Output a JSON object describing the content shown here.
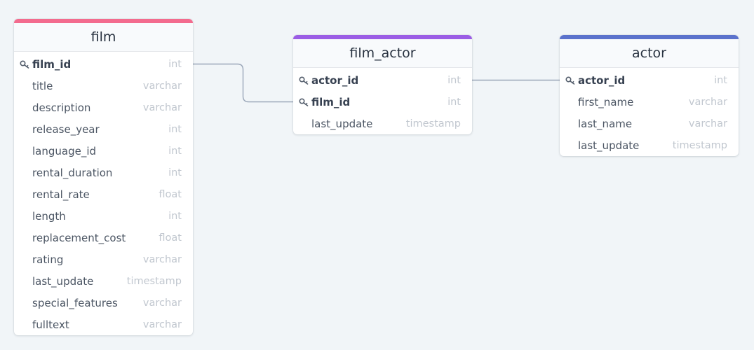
{
  "theme": {
    "background": "#f1f5f8",
    "link_color": "#9aa6b8"
  },
  "tables": [
    {
      "id": "film",
      "name": "film",
      "accent": "#f36b8e",
      "columns": [
        {
          "name": "film_id",
          "type": "int",
          "pk": true
        },
        {
          "name": "title",
          "type": "varchar",
          "pk": false
        },
        {
          "name": "description",
          "type": "varchar",
          "pk": false
        },
        {
          "name": "release_year",
          "type": "int",
          "pk": false
        },
        {
          "name": "language_id",
          "type": "int",
          "pk": false
        },
        {
          "name": "rental_duration",
          "type": "int",
          "pk": false
        },
        {
          "name": "rental_rate",
          "type": "float",
          "pk": false
        },
        {
          "name": "length",
          "type": "int",
          "pk": false
        },
        {
          "name": "replacement_cost",
          "type": "float",
          "pk": false
        },
        {
          "name": "rating",
          "type": "varchar",
          "pk": false
        },
        {
          "name": "last_update",
          "type": "timestamp",
          "pk": false
        },
        {
          "name": "special_features",
          "type": "varchar",
          "pk": false
        },
        {
          "name": "fulltext",
          "type": "varchar",
          "pk": false
        }
      ]
    },
    {
      "id": "film_actor",
      "name": "film_actor",
      "accent": "#9b5de5",
      "columns": [
        {
          "name": "actor_id",
          "type": "int",
          "pk": true
        },
        {
          "name": "film_id",
          "type": "int",
          "pk": true
        },
        {
          "name": "last_update",
          "type": "timestamp",
          "pk": false
        }
      ]
    },
    {
      "id": "actor",
      "name": "actor",
      "accent": "#5b72cc",
      "columns": [
        {
          "name": "actor_id",
          "type": "int",
          "pk": true
        },
        {
          "name": "first_name",
          "type": "varchar",
          "pk": false
        },
        {
          "name": "last_name",
          "type": "varchar",
          "pk": false
        },
        {
          "name": "last_update",
          "type": "timestamp",
          "pk": false
        }
      ]
    }
  ],
  "relationships": [
    {
      "from_table": "film",
      "from_column": "film_id",
      "to_table": "film_actor",
      "to_column": "film_id"
    },
    {
      "from_table": "film_actor",
      "from_column": "actor_id",
      "to_table": "actor",
      "to_column": "actor_id"
    }
  ]
}
